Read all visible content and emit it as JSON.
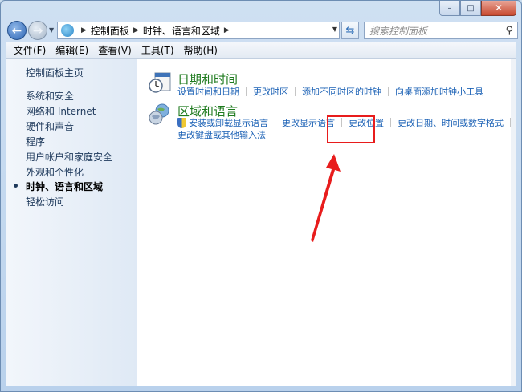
{
  "window": {
    "close_glyph": "✕",
    "max_glyph": "□",
    "min_glyph": "–"
  },
  "nav": {
    "breadcrumbs": [
      "控制面板",
      "时钟、语言和区域"
    ],
    "search_placeholder": "搜索控制面板"
  },
  "menu": [
    "文件(F)",
    "编辑(E)",
    "查看(V)",
    "工具(T)",
    "帮助(H)"
  ],
  "sidebar": {
    "home": "控制面板主页",
    "items": [
      "系统和安全",
      "网络和 Internet",
      "硬件和声音",
      "程序",
      "用户帐户和家庭安全",
      "外观和个性化",
      "时钟、语言和区域",
      "轻松访问"
    ],
    "current_index": 6
  },
  "categories": [
    {
      "title": "日期和时间",
      "links": [
        "设置时间和日期",
        "更改时区",
        "添加不同时区的时钟",
        "向桌面添加时钟小工具"
      ]
    },
    {
      "title": "区域和语言",
      "links": [
        "安装或卸载显示语言",
        "更改显示语言",
        "更改位置",
        "更改日期、时间或数字格式"
      ],
      "links2": [
        "更改键盘或其他输入法"
      ]
    }
  ],
  "colors": {
    "link": "#1e63b6",
    "category_title": "#1e7a1e",
    "annotation": "#e81c1c"
  }
}
